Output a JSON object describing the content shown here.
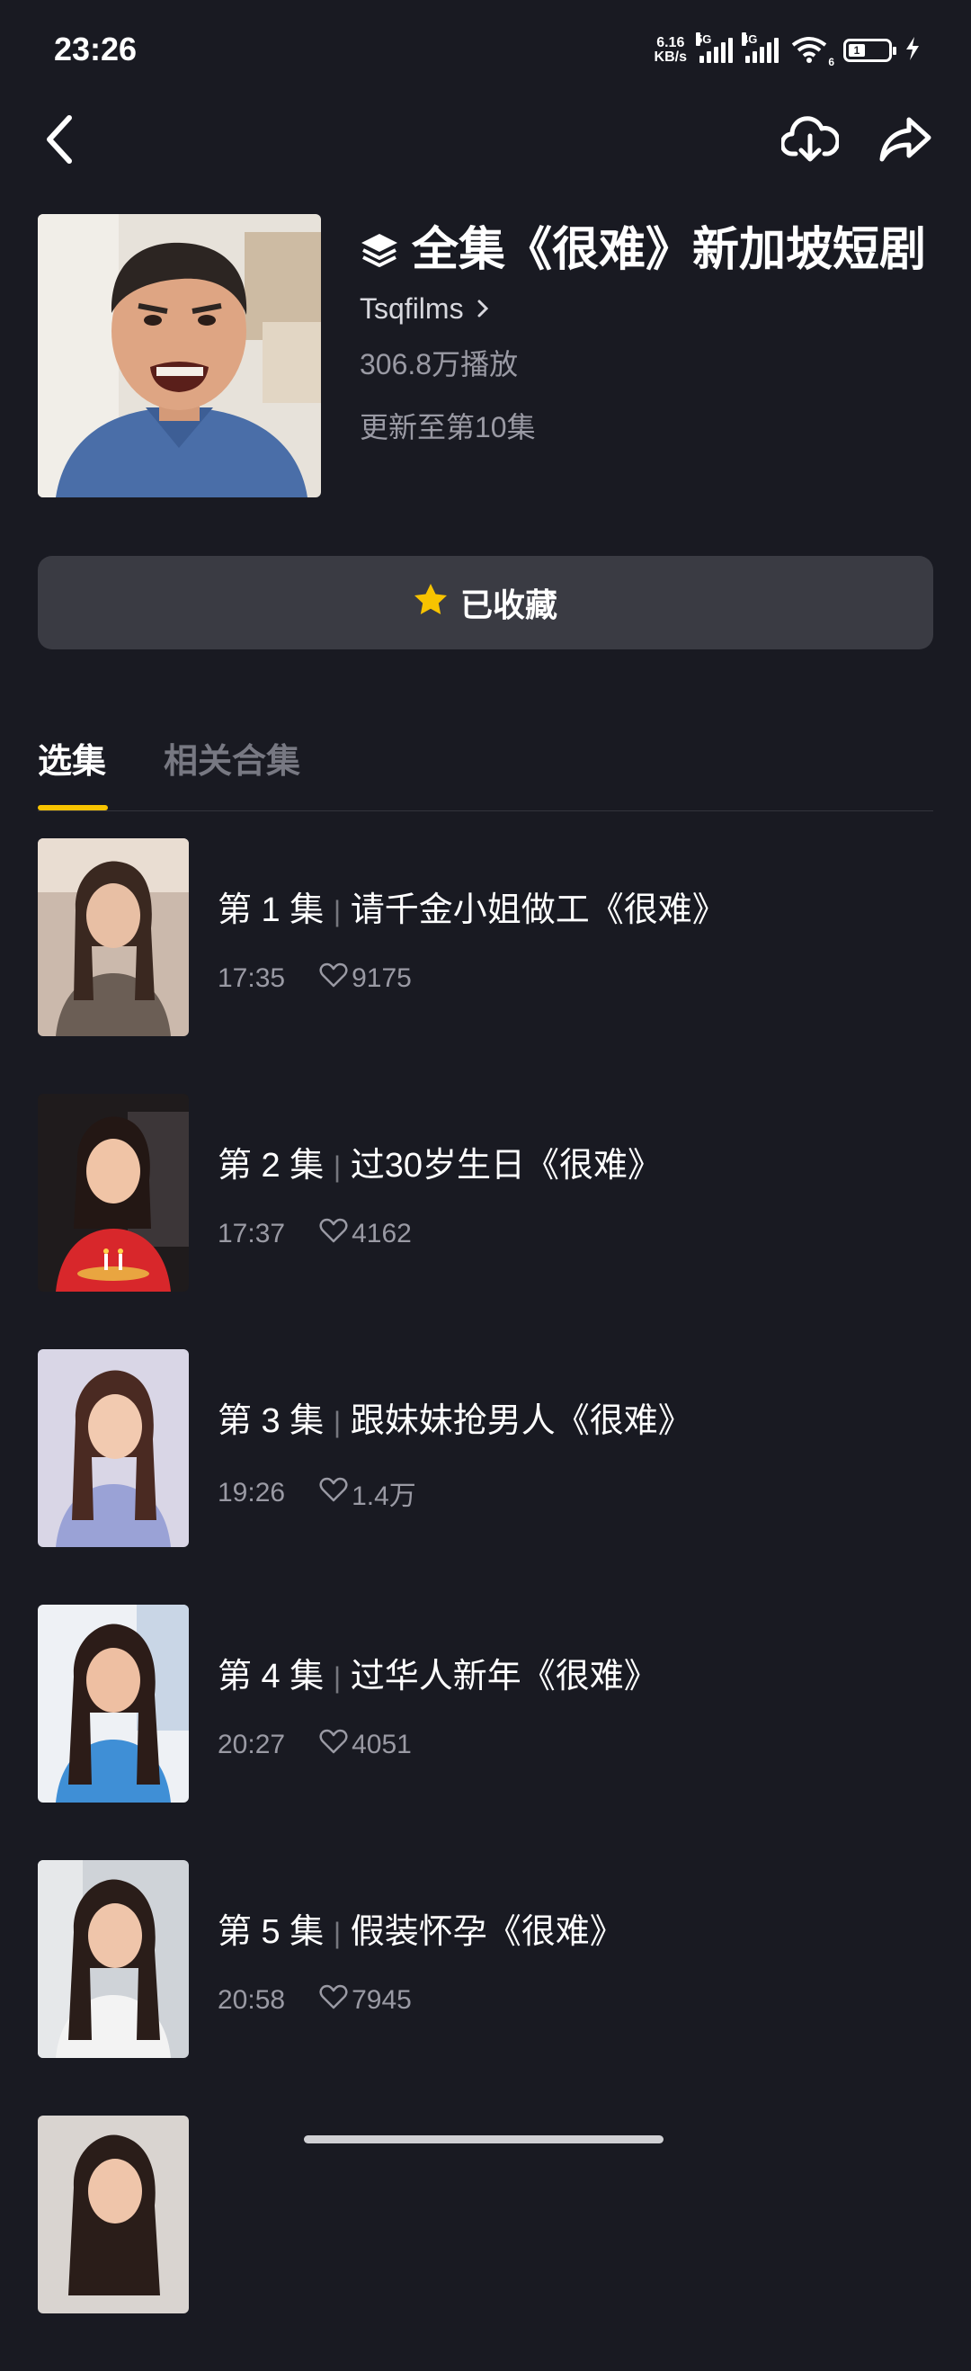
{
  "status_bar": {
    "time": "23:26",
    "net_speed_value": "6.16",
    "net_speed_unit": "KB/s",
    "sim1_tag": "5G",
    "sim2_tag": "4G",
    "wifi_tag": "6",
    "battery_level": "1"
  },
  "nav": {
    "back_icon": "chevron-left-icon",
    "download_icon": "cloud-download-icon",
    "share_icon": "share-arrow-icon"
  },
  "series": {
    "title": "全集《很难》新加坡短剧",
    "author": "Tsqfilms",
    "plays": "306.8万播放",
    "updated": "更新至第10集",
    "collect_label": "已收藏"
  },
  "tabs": [
    {
      "label": "选集",
      "active": true
    },
    {
      "label": "相关合集",
      "active": false
    }
  ],
  "episodes": [
    {
      "num": "第 1 集",
      "sep": "|",
      "name": "请千金小姐做工《很难》",
      "duration": "17:35",
      "likes": "9175"
    },
    {
      "num": "第 2 集",
      "sep": "|",
      "name": "过30岁生日《很难》",
      "duration": "17:37",
      "likes": "4162"
    },
    {
      "num": "第 3 集",
      "sep": "|",
      "name": "跟妹妹抢男人《很难》",
      "duration": "19:26",
      "likes": "1.4万"
    },
    {
      "num": "第 4 集",
      "sep": "|",
      "name": "过华人新年《很难》",
      "duration": "20:27",
      "likes": "4051"
    },
    {
      "num": "第 5 集",
      "sep": "|",
      "name": "假装怀孕《很难》",
      "duration": "20:58",
      "likes": "7945"
    }
  ],
  "colors": {
    "background": "#191a22",
    "accent": "#f7c300",
    "button_bg": "#3a3b43",
    "muted_text": "#9a9aa4"
  }
}
